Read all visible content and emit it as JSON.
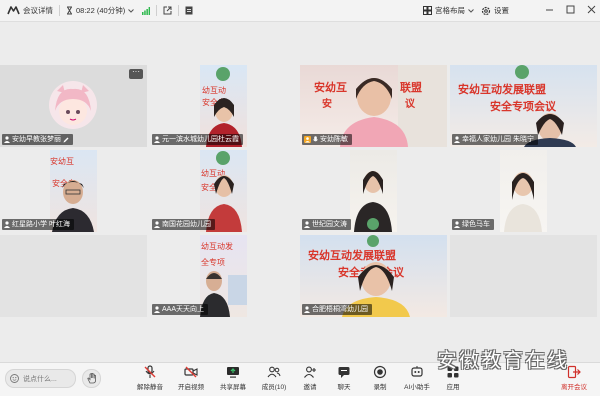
{
  "topbar": {
    "meeting_details": "会议详情",
    "time": "08:22 (40分钟)",
    "layout": "宫格布局",
    "settings": "设置"
  },
  "participants": [
    {
      "name": "安幼早教张梦丽",
      "has_banner": false,
      "avatar": true
    },
    {
      "name": "元一滨水城幼儿园杜云霞",
      "has_banner": true
    },
    {
      "name": "安幼陈敏",
      "has_banner": true,
      "speaking": true
    },
    {
      "name": "幸福人家幼儿园 朱晓宁",
      "has_banner": true
    },
    {
      "name": "红星路小学 叶红海",
      "has_banner": true
    },
    {
      "name": "南国花园幼儿园",
      "has_banner": true
    },
    {
      "name": "世纪园文涛",
      "has_banner": true
    },
    {
      "name": "绿色马车",
      "has_banner": false
    },
    {
      "name": "AAA天天向上",
      "has_banner": true
    },
    {
      "name": "合肥梧桐湾幼儿园",
      "has_banner": true
    }
  ],
  "banner_text": {
    "line1": "安幼互动发展联盟",
    "line2": "安全专项会议",
    "partial1": "幼互动",
    "partial2": "安全专"
  },
  "chat": {
    "placeholder": "说点什么..."
  },
  "toolbar": [
    {
      "label": "解除静音",
      "icon": "mic-muted-icon"
    },
    {
      "label": "开启视频",
      "icon": "camera-off-icon"
    },
    {
      "label": "共享屏幕",
      "icon": "share-screen-icon"
    },
    {
      "label": "成员(10)",
      "icon": "members-icon"
    },
    {
      "label": "邀请",
      "icon": "invite-icon"
    },
    {
      "label": "聊天",
      "icon": "chat-icon"
    },
    {
      "label": "录制",
      "icon": "record-icon"
    },
    {
      "label": "AI小助手",
      "icon": "ai-assistant-icon"
    },
    {
      "label": "应用",
      "icon": "apps-icon"
    },
    {
      "label": "离开会议",
      "icon": "leave-icon"
    }
  ],
  "watermark": "安徽教育在线",
  "colors": {
    "speaking_border": "#3bc36a",
    "leave_red": "#d0302a",
    "banner_red": "#d9362b"
  }
}
